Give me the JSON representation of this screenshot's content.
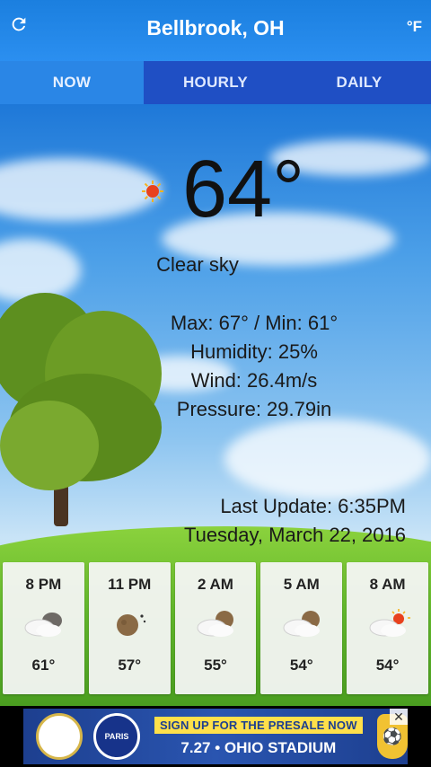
{
  "header": {
    "city": "Bellbrook, OH",
    "refresh_icon": "refresh-icon",
    "unit": "°F"
  },
  "tabs": [
    {
      "label": "NOW",
      "active": true
    },
    {
      "label": "HOURLY",
      "active": false
    },
    {
      "label": "DAILY",
      "active": false
    }
  ],
  "current": {
    "icon": "sun-icon",
    "temperature": "64°",
    "condition": "Clear sky",
    "max_min": "Max: 67° / Min: 61°",
    "humidity": "Humidity: 25%",
    "wind": "Wind: 26.4m/s",
    "pressure": "Pressure: 29.79in",
    "last_update": "Last Update: 6:35PM",
    "date": "Tuesday, March 22, 2016"
  },
  "hourly": [
    {
      "time": "8 PM",
      "icon": "partly-cloudy-night-icon",
      "temp": "61°"
    },
    {
      "time": "11 PM",
      "icon": "clear-night-icon",
      "temp": "57°"
    },
    {
      "time": "2 AM",
      "icon": "partly-cloudy-night-icon",
      "temp": "55°"
    },
    {
      "time": "5 AM",
      "icon": "partly-cloudy-night-icon",
      "temp": "54°"
    },
    {
      "time": "8 AM",
      "icon": "partly-cloudy-day-icon",
      "temp": "54°"
    }
  ],
  "ad": {
    "presale": "SIGN UP FOR THE PRESALE NOW",
    "venue": "7.27 • OHIO STADIUM",
    "club1": "",
    "club2": "PARIS",
    "close": "✕"
  },
  "colors": {
    "header_bg": "#2b8ff0",
    "tab_bar": "#1f4fc4",
    "tab_active": "#2a86e6"
  }
}
